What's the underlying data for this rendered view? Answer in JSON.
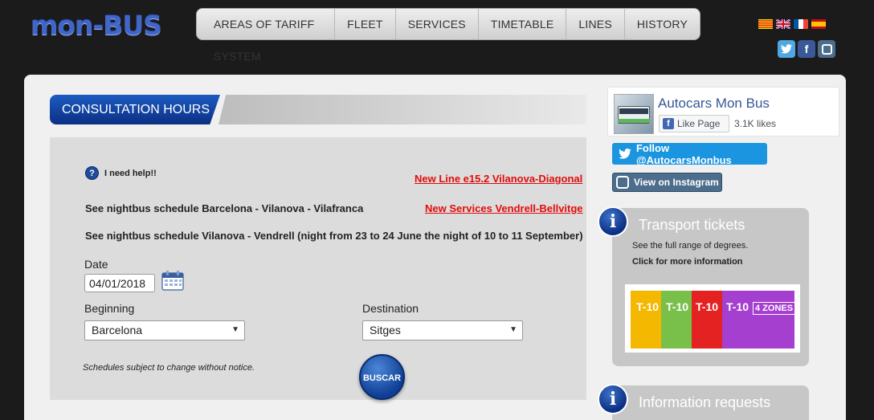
{
  "header": {
    "logo": "mon-BUS",
    "nav": [
      "AREAS OF TARIFF SYSTEM",
      "FLEET",
      "SERVICES",
      "TIMETABLE",
      "LINES",
      "HISTORY"
    ],
    "flags": [
      "catalan-flag",
      "uk-flag",
      "france-flag",
      "spain-flag"
    ],
    "social": [
      "twitter-icon",
      "facebook-icon",
      "instagram-icon"
    ]
  },
  "section": {
    "title": "CONSULTATION HOURS"
  },
  "help": {
    "label": "I need help!!",
    "icon": "?"
  },
  "links": {
    "new_line": "New Line e15.2 Vilanova-Diagonal",
    "new_services": "New Services Vendrell-Bellvitge"
  },
  "night": {
    "line1": "See nightbus schedule Barcelona - Vilanova - Vilafranca",
    "line2": "See nightbus schedule Vilanova - Vendrell (night from 23 to 24 June the night of 10 to 11 September)"
  },
  "form": {
    "date_label": "Date",
    "date_value": "04/01/2018",
    "beginning_label": "Beginning",
    "beginning_value": "Barcelona",
    "destination_label": "Destination",
    "destination_value": "Sitges",
    "disclaimer": "Schedules subject to change without notice.",
    "submit": "BUSCAR"
  },
  "facebook": {
    "title": "Autocars Mon Bus",
    "like": "Like Page",
    "count": "3.1K likes"
  },
  "twitter": {
    "label": "Follow @AutocarsMonbus"
  },
  "instagram": {
    "label": "View on Instagram"
  },
  "tickets_card": {
    "icon": "i",
    "title": "Transport tickets",
    "text1": "See the full range of degrees.",
    "text2": "Click for more information",
    "strips": [
      "T-10",
      "T-10",
      "T-10",
      "T-10",
      "4 ZONES"
    ]
  },
  "info_card": {
    "icon": "i",
    "title": "Information requests"
  },
  "colors": {
    "accent": "#0b2f83",
    "link": "#e30b0b",
    "twitter": "#1b95e0"
  }
}
